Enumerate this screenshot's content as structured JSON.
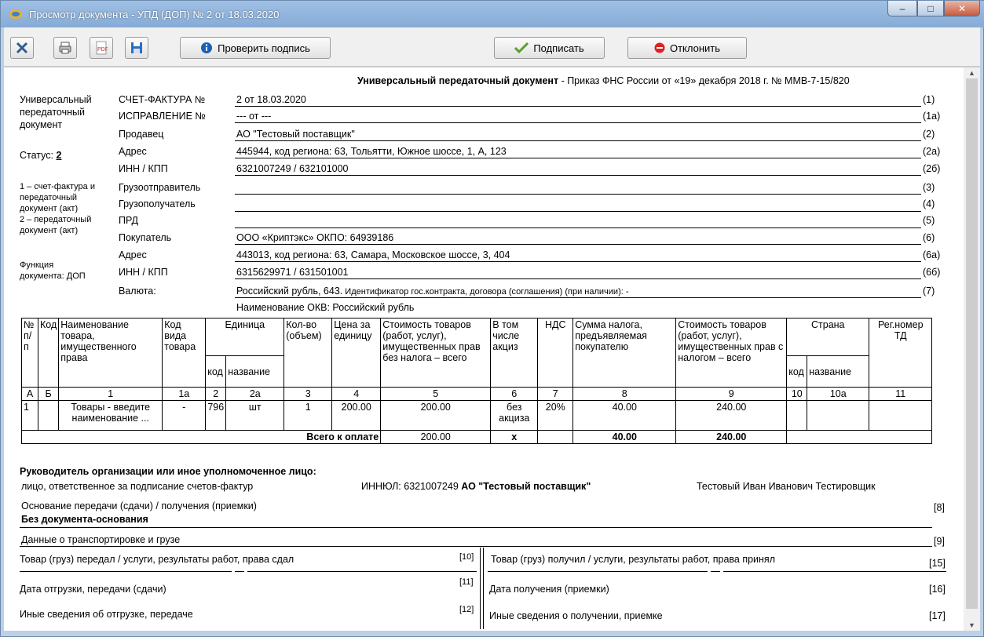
{
  "window": {
    "title": "Просмотр документа - УПД (ДОП) № 2 от 18.03.2020",
    "min": "–",
    "max": "□",
    "close": "✕"
  },
  "toolbar": {
    "verify_label": "Проверить подпись",
    "sign_label": "Подписать",
    "reject_label": "Отклонить"
  },
  "doc": {
    "header_bold": "Универсальный передаточный документ",
    "header_rest": " - Приказ ФНС России от «19» декабря 2018 г. № ММВ-7-15/820",
    "left_title1": "Универсальный",
    "left_title2": "передаточный",
    "left_title3": "документ",
    "status_label": "Статус:",
    "status_value": "2",
    "status_desc1": "1 – счет-фактура и",
    "status_desc2": "передаточный",
    "status_desc3": "документ (акт)",
    "status_desc4": "2 – передаточный",
    "status_desc5": "документ (акт)",
    "function_label1": "Функция",
    "function_label2": "документа: ДОП",
    "fields": [
      {
        "label": "СЧЕТ-ФАКТУРА №",
        "value": "2 от 18.03.2020",
        "code": "(1)"
      },
      {
        "label": "ИСПРАВЛЕНИЕ №",
        "value": "--- от ---",
        "code": "(1а)"
      },
      {
        "label": "Продавец",
        "value": "АО \"Тестовый поставщик\"",
        "code": "(2)"
      },
      {
        "label": "Адрес",
        "value": "445944, код региона: 63, Тольятти, Южное шоссе, 1, А, 123",
        "code": "(2а)"
      },
      {
        "label": "ИНН / КПП",
        "value": "6321007249 / 632101000",
        "code": "(2б)"
      },
      {
        "label": "Грузоотправитель",
        "value": "",
        "code": "(3)"
      },
      {
        "label": "Грузополучатель",
        "value": "",
        "code": "(4)"
      },
      {
        "label": "ПРД",
        "value": "",
        "code": "(5)"
      },
      {
        "label": "Покупатель",
        "value": "ООО «Криптэкс» ОКПО: 64939186",
        "code": "(6)"
      },
      {
        "label": "Адрес",
        "value": "443013, код региона: 63, Самара, Московское шоссе, 3, 404",
        "code": "(6а)"
      },
      {
        "label": "ИНН / КПП",
        "value": "6315629971 / 631501001",
        "code": "(6б)"
      }
    ],
    "currency_label": "Валюта:",
    "currency_value1": "Российский рубль, 643.",
    "currency_value2": " Идентификатор гос.контракта, договора (соглашения) (при наличии): -",
    "currency_code": "(7)",
    "okv": "Наименование ОКВ: Российский рубль"
  },
  "table": {
    "h_num": "№ п/п",
    "h_kod": "Код",
    "h_name": "Наименование товара, имущественного права",
    "h_kind": "Код вида товара",
    "h_unit": "Единица",
    "h_unit_code": "код",
    "h_unit_name": "название",
    "h_qty": "Кол-во (объем)",
    "h_price": "Цена за единицу",
    "h_cost": "Стоимость товаров (работ, услуг), имущественных прав без налога – всего",
    "h_excise": "В том числе акциз",
    "h_vat": "НДС",
    "h_tax": "Сумма налога, предъявляемая покупателю",
    "h_total": "Стоимость товаров (работ, услуг), имущественных прав с налогом – всего",
    "h_country": "Страна",
    "h_country_code": "код",
    "h_country_name": "название",
    "h_reg": "Рег.номер ТД",
    "letters": [
      "А",
      "Б",
      "1",
      "1а",
      "2",
      "2а",
      "3",
      "4",
      "5",
      "6",
      "7",
      "8",
      "9",
      "10",
      "10а",
      "11"
    ],
    "row": {
      "num": "1",
      "kod": "",
      "name": "Товары - введите наименование ...",
      "kind": "-",
      "unit_code": "796",
      "unit_name": "шт",
      "qty": "1",
      "price": "200.00",
      "cost": "200.00",
      "excise": "без акциза",
      "vat": "20%",
      "tax": "40.00",
      "total": "240.00",
      "country_code": "",
      "country_name": "",
      "reg": ""
    },
    "total_label": "Всего к оплате",
    "total_cost": "200.00",
    "total_excise": "x",
    "total_tax": "40.00",
    "total_total": "240.00"
  },
  "footer": {
    "head_label": "Руководитель организации или иное уполномоченное лицо:",
    "responsible": "лицо, ответственное за подписание счетов-фактур",
    "innul_label": "ИННЮЛ: 6321007249 ",
    "org_name": "АО \"Тестовый поставщик\"",
    "signer": "Тестовый Иван Иванович  Тестировщик",
    "basis_label": "Основание передачи (сдачи) / получения (приемки)",
    "basis_code": "[8]",
    "basis_value": "Без документа-основания",
    "transport_label": "Данные о транспортировке и грузе",
    "transport_code": "[9]",
    "gave_label": "Товар (груз) передал / услуги, результаты работ, права сдал",
    "gave_code": "[10]",
    "got_label": "Товар (груз) получил / услуги, результаты работ, права принял",
    "got_code": "[15]",
    "ship_date_label": "Дата отгрузки, передачи (сдачи)",
    "ship_date_code": "[11]",
    "recv_date_label": "Дата получения (приемки)",
    "recv_date_code": "[16]",
    "ship_other_label": "Иные сведения об отгрузке, передаче",
    "ship_other_code": "[12]",
    "recv_other_label": "Иные сведения о получении, приемке",
    "recv_other_code": "[17]"
  },
  "colors": {
    "title_bg": "#8fb4dc",
    "toolbar_bg": "#f0f0f0",
    "close_btn": "#c75a3f"
  },
  "icons": [
    "app-icon",
    "tools-icon",
    "print-icon",
    "pdf-icon",
    "save-icon",
    "info-icon",
    "checkmark-icon",
    "reject-icon"
  ]
}
